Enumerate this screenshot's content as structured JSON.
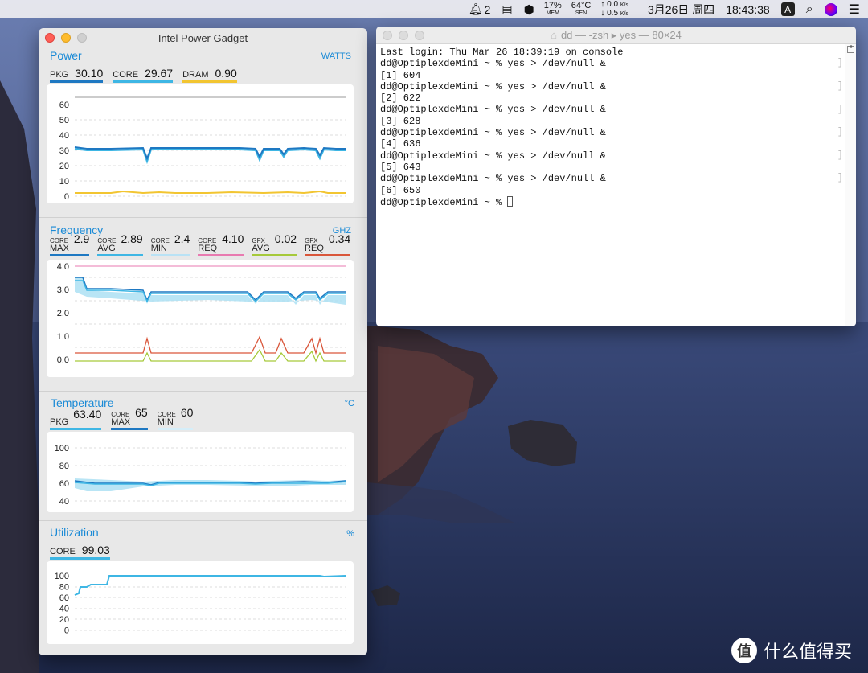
{
  "menubar": {
    "notifications": "2",
    "mem_value": "17%",
    "mem_label": "MEM",
    "sen_value": "64°C",
    "sen_label": "SEN",
    "net_up": "↑ 0.0",
    "net_down": "↓ 0.5",
    "net_unit": "K/s",
    "date": "3月26日 周四",
    "time": "18:43:38",
    "input_method": "A"
  },
  "gadget": {
    "title": "Intel Power Gadget",
    "power": {
      "title": "Power",
      "unit": "WATTS",
      "metrics": [
        {
          "label": "PKG",
          "value": "30.10",
          "color": "#1e78c2"
        },
        {
          "label": "CORE",
          "value": "29.67",
          "color": "#3eb6e4"
        },
        {
          "label": "DRAM",
          "value": "0.90",
          "color": "#f2c531"
        }
      ],
      "yticks": [
        "60",
        "50",
        "40",
        "30",
        "20",
        "10",
        "0"
      ]
    },
    "frequency": {
      "title": "Frequency",
      "unit": "GHZ",
      "metrics": [
        {
          "top": "CORE",
          "bottom": "MAX",
          "value": "2.9",
          "color": "#1e78c2"
        },
        {
          "top": "CORE",
          "bottom": "AVG",
          "value": "2.89",
          "color": "#3eb6e4"
        },
        {
          "top": "CORE",
          "bottom": "MIN",
          "value": "2.4",
          "color": "#b9e2f5"
        },
        {
          "top": "CORE",
          "bottom": "REQ",
          "value": "4.10",
          "color": "#e87ab0"
        },
        {
          "top": "GFX",
          "bottom": "AVG",
          "value": "0.02",
          "color": "#a6c93a"
        },
        {
          "top": "GFX",
          "bottom": "REQ",
          "value": "0.34",
          "color": "#d9563a"
        }
      ],
      "yticks": [
        "4.0",
        "3.0",
        "2.0",
        "1.0",
        "0.0"
      ]
    },
    "temperature": {
      "title": "Temperature",
      "unit": "°C",
      "metrics": [
        {
          "top": "",
          "bottom": "PKG",
          "value": "63.40",
          "color": "#3eb6e4"
        },
        {
          "top": "CORE",
          "bottom": "MAX",
          "value": "65",
          "color": "#1e78c2"
        },
        {
          "top": "CORE",
          "bottom": "MIN",
          "value": "60",
          "color": "#b9e2f5"
        }
      ],
      "yticks": [
        "100",
        "80",
        "60",
        "40"
      ]
    },
    "utilization": {
      "title": "Utilization",
      "unit": "%",
      "metrics": [
        {
          "label": "CORE",
          "value": "99.03",
          "color": "#3eb6e4"
        }
      ],
      "yticks": [
        "100",
        "80",
        "60",
        "40",
        "20",
        "0"
      ]
    }
  },
  "terminal": {
    "title": "dd — -zsh ▸ yes — 80×24",
    "lines": [
      "Last login: Thu Mar 26 18:39:19 on console",
      "dd@OptiplexdeMini ~ % yes > /dev/null &",
      "[1] 604",
      "dd@OptiplexdeMini ~ % yes > /dev/null &",
      "[2] 622",
      "dd@OptiplexdeMini ~ % yes > /dev/null &",
      "[3] 628",
      "dd@OptiplexdeMini ~ % yes > /dev/null &",
      "[4] 636",
      "dd@OptiplexdeMini ~ % yes > /dev/null &",
      "[5] 643",
      "dd@OptiplexdeMini ~ % yes > /dev/null &",
      "[6] 650"
    ],
    "prompt": "dd@OptiplexdeMini ~ % "
  },
  "watermark": {
    "logo": "值",
    "text": "什么值得买"
  }
}
